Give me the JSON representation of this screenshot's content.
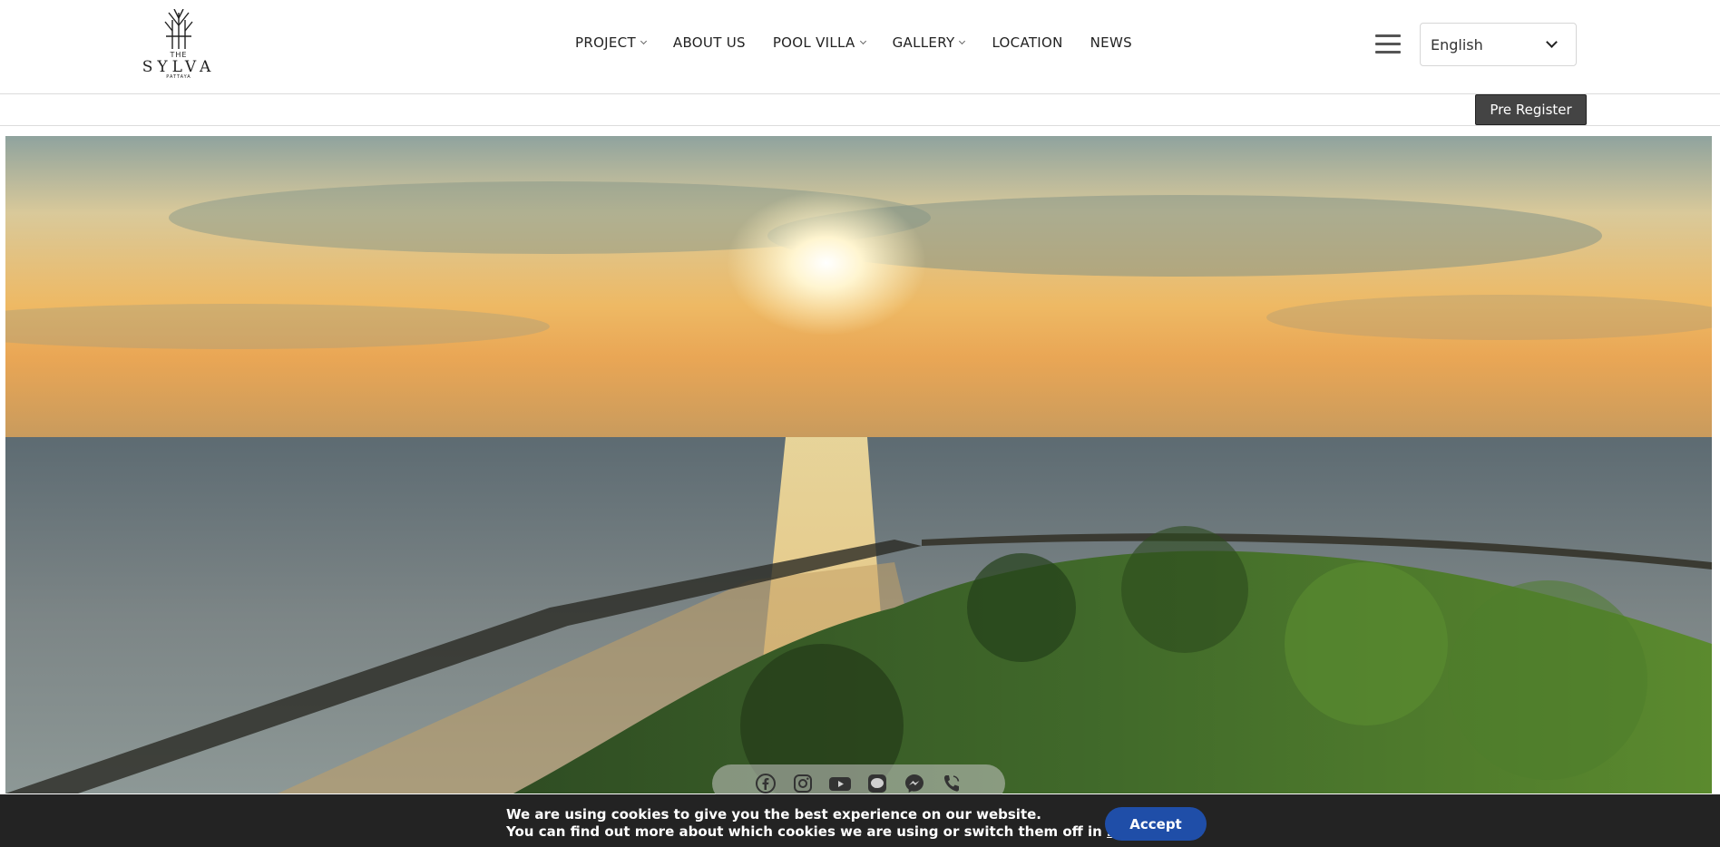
{
  "brand": {
    "logo_the": "THE",
    "logo_name": "SYLVA",
    "logo_sub": "PATTAYA"
  },
  "nav": {
    "items": [
      {
        "label": "PROJECT",
        "dropdown": true
      },
      {
        "label": "ABOUT US",
        "dropdown": false
      },
      {
        "label": "POOL VILLA",
        "dropdown": true
      },
      {
        "label": "GALLERY",
        "dropdown": true
      },
      {
        "label": "LOCATION",
        "dropdown": false
      },
      {
        "label": "NEWS",
        "dropdown": false
      }
    ]
  },
  "language": {
    "selected": "English"
  },
  "actions": {
    "pre_register": "Pre Register"
  },
  "social": {
    "icons": [
      "facebook-icon",
      "instagram-icon",
      "youtube-icon",
      "line-icon",
      "messenger-icon",
      "phone-icon"
    ]
  },
  "cookie": {
    "line1": "We are using cookies to give you the best experience on our website.",
    "line2_prefix": "You can find out more about which cookies we are using or switch them off in ",
    "line2_link": "settings",
    "line2_suffix": ".",
    "accept_label": "Accept"
  },
  "colors": {
    "accept_button": "#1f4ea8",
    "cookie_bg": "#232323",
    "pre_register_bg": "#444444"
  }
}
